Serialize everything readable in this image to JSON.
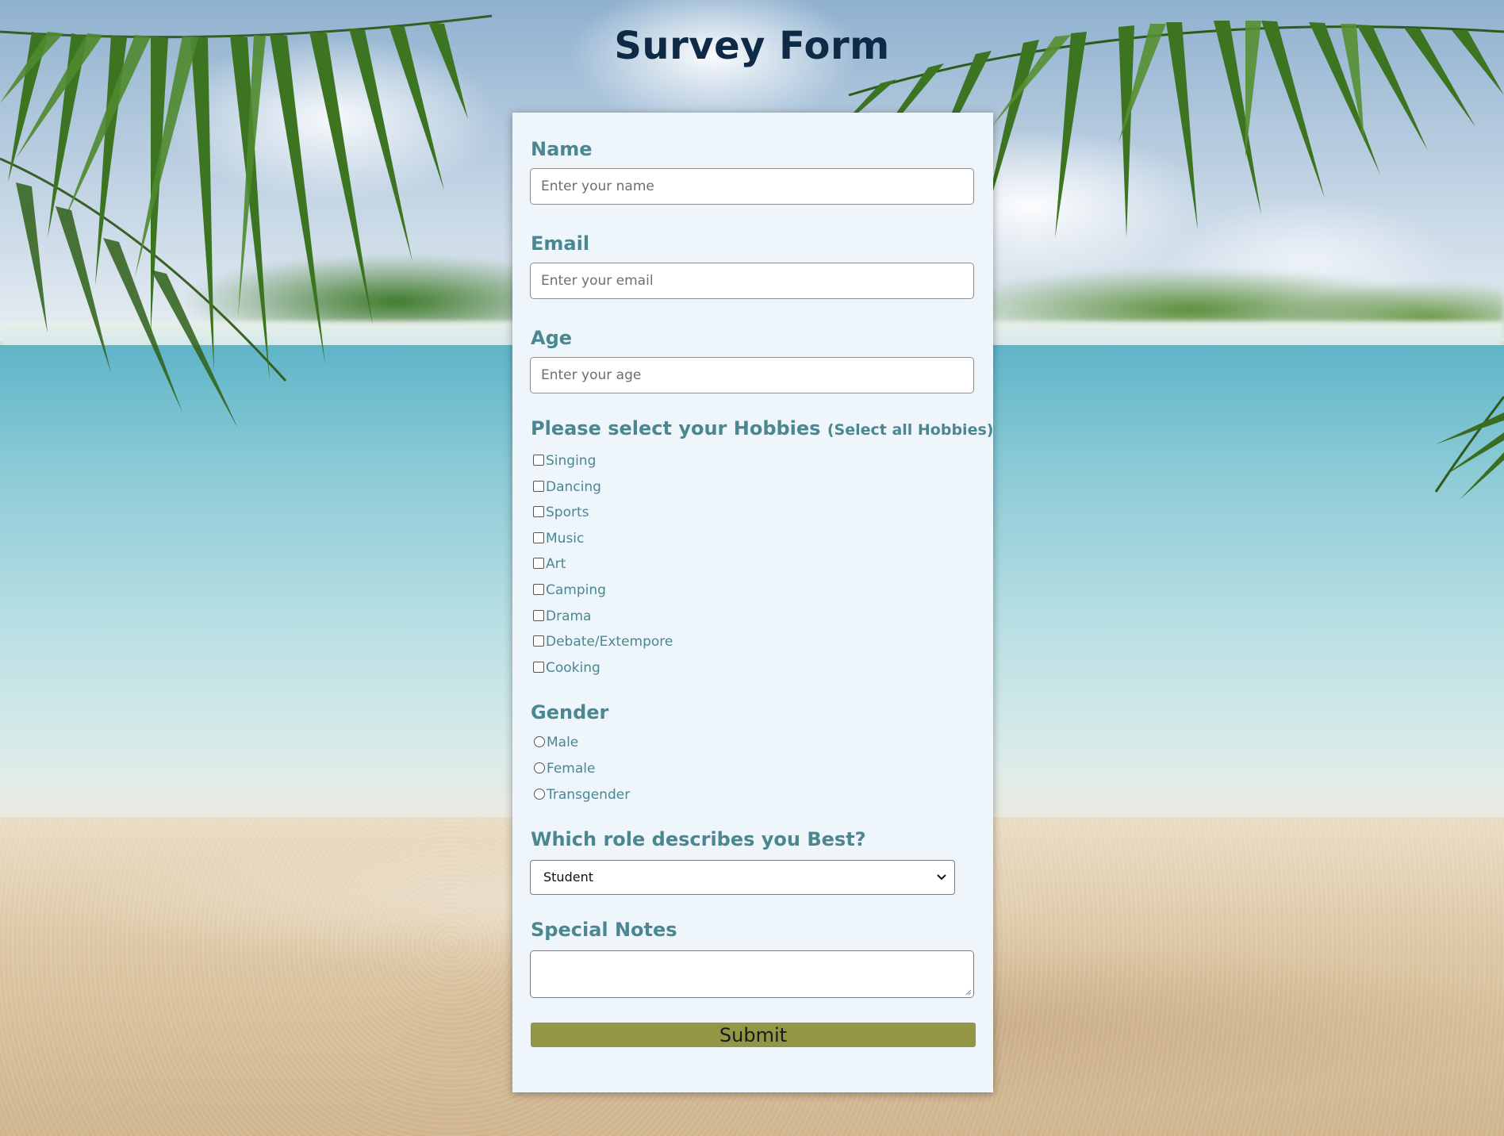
{
  "page": {
    "title": "Survey Form"
  },
  "form": {
    "name": {
      "label": "Name",
      "placeholder": "Enter your name"
    },
    "email": {
      "label": "Email",
      "placeholder": "Enter your email"
    },
    "age": {
      "label": "Age",
      "placeholder": "Enter your age"
    },
    "hobbies": {
      "heading": "Please select your Hobbies",
      "subheading": "(Select all Hobbies)",
      "options": [
        {
          "label": "Singing",
          "checked": false
        },
        {
          "label": "Dancing",
          "checked": false
        },
        {
          "label": "Sports",
          "checked": false
        },
        {
          "label": "Music",
          "checked": false
        },
        {
          "label": "Art",
          "checked": false
        },
        {
          "label": "Camping",
          "checked": false
        },
        {
          "label": "Drama",
          "checked": false
        },
        {
          "label": "Debate/Extempore",
          "checked": false
        },
        {
          "label": "Cooking",
          "checked": false
        }
      ]
    },
    "gender": {
      "label": "Gender",
      "options": [
        {
          "label": "Male",
          "selected": false
        },
        {
          "label": "Female",
          "selected": false
        },
        {
          "label": "Transgender",
          "selected": false
        }
      ]
    },
    "role": {
      "label": "Which role describes you Best?",
      "selected": "Student"
    },
    "notes": {
      "label": "Special Notes",
      "value": ""
    },
    "submit_label": "Submit"
  },
  "colors": {
    "title": "#0f2a47",
    "label": "#4a8791",
    "card_background": "#eef6fc",
    "submit_button": "#929645"
  },
  "icons": {
    "select_arrow": "chevron-down-icon",
    "textarea_resize": "resize-grip-icon"
  }
}
